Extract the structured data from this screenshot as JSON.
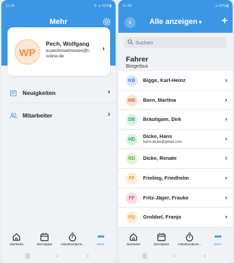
{
  "left": {
    "status": {
      "time": "11:39",
      "icons_right": "⚲ ⊿ 52%▮"
    },
    "header_title": "Mehr",
    "profile": {
      "initials": "WP",
      "name": "Pech, Wolfgang",
      "email": "w.pechmoehnesee@t-online.de"
    },
    "menu": [
      {
        "label": "Neuigkeiten",
        "icon": "news-icon"
      },
      {
        "label": "Mitarbeiter",
        "icon": "people-icon"
      }
    ]
  },
  "right": {
    "status": {
      "time": "11:39",
      "icons_right": "⊿ 52%▮"
    },
    "header_title": "Alle anzeigen",
    "search_placeholder": "Suchen",
    "section_title": "Fahrer",
    "section_subtitle": "Bürgerbus",
    "people": [
      {
        "initials": "KB",
        "name": "Bigge, Karl-Heinz",
        "sub": "",
        "bg": "#dbe8fb",
        "fg": "#3a78c9"
      },
      {
        "initials": "MB",
        "name": "Born, Martina",
        "sub": "",
        "bg": "#fde1d6",
        "fg": "#e0683f"
      },
      {
        "initials": "DB",
        "name": "Bräutigam, Dirk",
        "sub": "",
        "bg": "#d8f3e4",
        "fg": "#2aa663"
      },
      {
        "initials": "HD",
        "name": "Dicke, Hans",
        "sub": "hans.dicke@gmail.com",
        "bg": "#d8f3e4",
        "fg": "#2aa663"
      },
      {
        "initials": "RD",
        "name": "Dicke, Renate",
        "sub": "",
        "bg": "#e6f2d6",
        "fg": "#6aa830"
      },
      {
        "initials": "FF",
        "name": "Frieling, Friedhelm",
        "sub": "",
        "bg": "#fdecd4",
        "fg": "#e5952c"
      },
      {
        "initials": "FF",
        "name": "Fritz-Jäger, Frauke",
        "sub": "",
        "bg": "#fbdbe0",
        "fg": "#e04864"
      },
      {
        "initials": "FG",
        "name": "Grobbel, Franjo",
        "sub": "",
        "bg": "#fdecd4",
        "fg": "#e5952c"
      }
    ]
  },
  "tabs": [
    {
      "label": "Startseite",
      "icon": "home-icon"
    },
    {
      "label": "Dienstplan",
      "icon": "calendar-icon"
    },
    {
      "label": "Arbeitszeitprot...",
      "icon": "stopwatch-icon"
    },
    {
      "label": "Mehr",
      "icon": "more-dots-icon"
    }
  ],
  "colors": {
    "accent": "#3b97e5",
    "background": "#f0f2f5"
  }
}
